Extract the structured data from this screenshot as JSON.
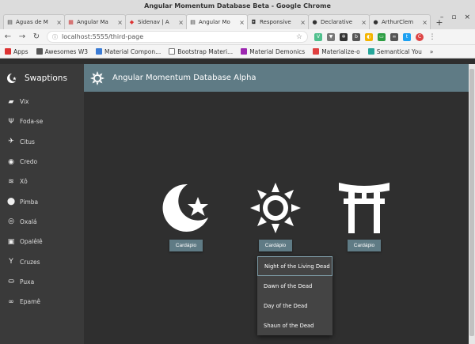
{
  "window": {
    "title": "Angular Momentum Database Beta - Google Chrome"
  },
  "tabs": [
    {
      "label": "Águas de M",
      "icon": "document-icon",
      "active": false
    },
    {
      "label": "Angular Ma",
      "icon": "angular-material-icon",
      "active": false
    },
    {
      "label": "Sidenav | A",
      "icon": "angular-icon",
      "active": false
    },
    {
      "label": "Angular Mo",
      "icon": "document-icon",
      "active": true
    },
    {
      "label": "Responsive",
      "icon": "responsive-icon",
      "active": false
    },
    {
      "label": "Declarative",
      "icon": "github-icon",
      "active": false
    },
    {
      "label": "ArthurClem",
      "icon": "github-icon",
      "active": false
    }
  ],
  "toolbar": {
    "url": "localhost:5555/third-page"
  },
  "bookmarks": [
    {
      "label": "Apps",
      "color": "#d33"
    },
    {
      "label": "Awesomes W3",
      "color": "#555"
    },
    {
      "label": "Material Compon...",
      "color": "#3a7bd5"
    },
    {
      "label": "Bootstrap Materi...",
      "color": "#777"
    },
    {
      "label": "Material Demonics",
      "color": "#9c27b0"
    },
    {
      "label": "Materialize-o",
      "color": "#e04040"
    },
    {
      "label": "Semantical You",
      "color": "#26a69a"
    }
  ],
  "sidebar": {
    "brand": "Swaptions",
    "items": [
      {
        "label": "Vix",
        "icon": "briefcase-icon",
        "glyph": "▰"
      },
      {
        "label": "Foda-se",
        "icon": "restaurant-icon",
        "glyph": "Ψ"
      },
      {
        "label": "Citus",
        "icon": "walk-icon",
        "glyph": "✈"
      },
      {
        "label": "Credo",
        "icon": "wifi-tethering-icon",
        "glyph": "◉"
      },
      {
        "label": "Xô",
        "icon": "waves-icon",
        "glyph": "≋"
      },
      {
        "label": "Pimba",
        "icon": "location-icon",
        "glyph": "⬤"
      },
      {
        "label": "Oxalá",
        "icon": "bubbles-icon",
        "glyph": "◎"
      },
      {
        "label": "Opalêlê",
        "icon": "package-icon",
        "glyph": "▣"
      },
      {
        "label": "Cruzes",
        "icon": "cocktail-icon",
        "glyph": "Y"
      },
      {
        "label": "Puxa",
        "icon": "bathtub-icon",
        "glyph": "⛀"
      },
      {
        "label": "Epamê",
        "icon": "infinity-icon",
        "glyph": "∞"
      }
    ]
  },
  "header": {
    "title": "Angular Momentum Database Alpha"
  },
  "cards": [
    {
      "icon": "star-and-crescent-icon",
      "button": "Cardápio"
    },
    {
      "icon": "sun-icon",
      "button": "Cardápio"
    },
    {
      "icon": "torii-gate-icon",
      "button": "Cardápio"
    }
  ],
  "dropdown": {
    "items": [
      "Night of the Living Dead",
      "Dawn of the Dead",
      "Day of the Dead",
      "Shaun of the Dead"
    ]
  },
  "colors": {
    "accent": "#5f7b85",
    "sidebar": "#3a3a3a",
    "content": "#2f2f2f"
  }
}
